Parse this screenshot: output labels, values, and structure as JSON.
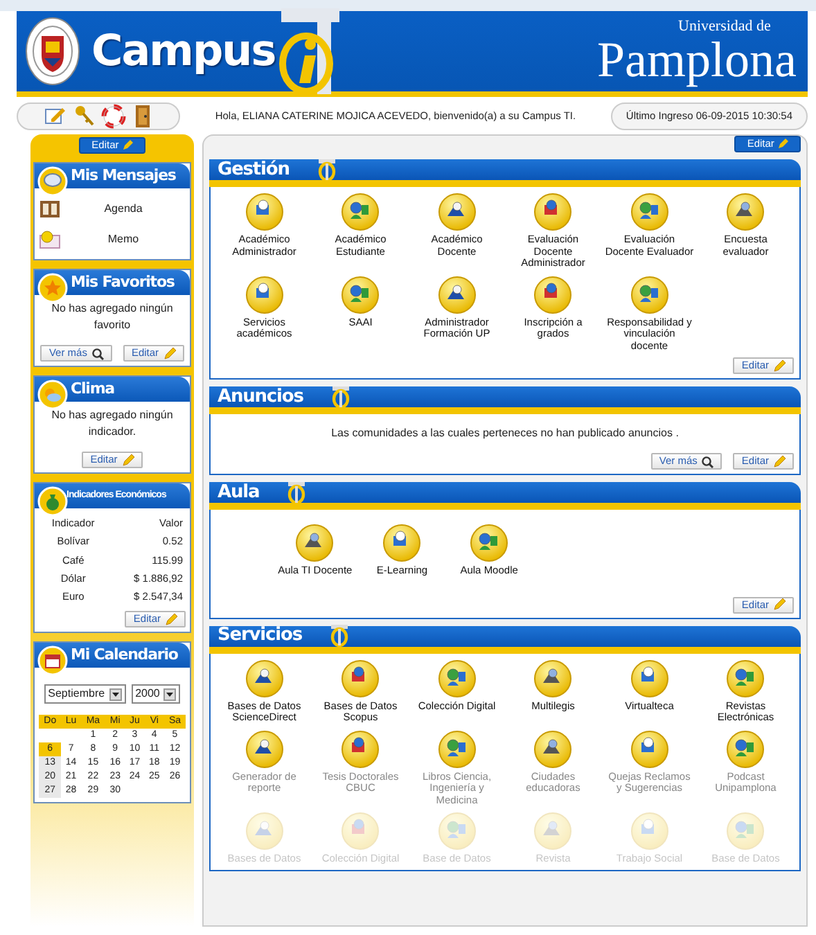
{
  "header": {
    "brand": "Campus",
    "university_small": "Universidad de",
    "university_name": "Pamplona"
  },
  "toolbar": {
    "icons": [
      {
        "kind": "edit"
      },
      {
        "kind": "keys"
      },
      {
        "kind": "lifebuoy"
      },
      {
        "kind": "door"
      }
    ]
  },
  "greeting": "Hola, ELIANA CATERINE MOJICA ACEVEDO, bienvenido(a) a su Campus TI.",
  "last_login": "Último Ingreso 06-09-2015 10:30:54",
  "sidebar": {
    "edit_button": "Editar",
    "widgets": [
      {
        "kind": "messages",
        "title": "Mis Mensajes",
        "items": [
          {
            "label": "Agenda"
          },
          {
            "label": "Memo"
          }
        ]
      },
      {
        "kind": "favorites",
        "title": "Mis Favoritos",
        "text": "No has agregado ningún favorito",
        "buttons": [
          {
            "kind": "search",
            "label": "Ver más"
          },
          {
            "kind": "edit",
            "label": "Editar"
          }
        ]
      },
      {
        "kind": "weather",
        "title": "Clima",
        "text": "No has agregado ningún indicador.",
        "buttons": [
          {
            "kind": "edit",
            "label": "Editar"
          }
        ]
      },
      {
        "kind": "indicators",
        "title": "Indicadores Económicos",
        "columns": [
          "Indicador",
          "Valor"
        ],
        "rows": [
          [
            "Bolívar",
            "0.52"
          ],
          [
            "Café",
            "115.99"
          ],
          [
            "Dólar",
            "$ 1.886,92"
          ],
          [
            "Euro",
            "$ 2.547,34"
          ]
        ],
        "buttons": [
          {
            "kind": "edit",
            "label": "Editar"
          }
        ]
      },
      {
        "kind": "calendar",
        "title": "Mi Calendario",
        "month": "Septiembre",
        "year": "2000",
        "weekdays": [
          "Do",
          "Lu",
          "Ma",
          "Mi",
          "Ju",
          "Vi",
          "Sa"
        ],
        "weeks": [
          [
            {
              "day": "1",
              "selected": false
            },
            {
              "day": "2",
              "selected": false
            },
            {
              "day": "3",
              "selected": false
            },
            {
              "day": "4",
              "selected": false
            },
            {
              "day": "5",
              "selected": false
            }
          ],
          [
            {
              "day": "6",
              "selected": true
            },
            {
              "day": "7",
              "selected": false
            },
            {
              "day": "8",
              "selected": false
            },
            {
              "day": "9",
              "selected": false
            },
            {
              "day": "10",
              "selected": false
            },
            {
              "day": "11",
              "selected": false
            },
            {
              "day": "12",
              "selected": false
            }
          ],
          [
            {
              "day": "13",
              "selected": false
            },
            {
              "day": "14",
              "selected": false
            },
            {
              "day": "15",
              "selected": false
            },
            {
              "day": "16",
              "selected": false
            },
            {
              "day": "17",
              "selected": false
            },
            {
              "day": "18",
              "selected": false
            },
            {
              "day": "19",
              "selected": false
            }
          ],
          [
            {
              "day": "20",
              "selected": false
            },
            {
              "day": "21",
              "selected": false
            },
            {
              "day": "22",
              "selected": false
            },
            {
              "day": "23",
              "selected": false
            },
            {
              "day": "24",
              "selected": false
            },
            {
              "day": "25",
              "selected": false
            },
            {
              "day": "26",
              "selected": false
            }
          ],
          [
            {
              "day": "27",
              "selected": false
            },
            {
              "day": "28",
              "selected": false
            },
            {
              "day": "29",
              "selected": false
            },
            {
              "day": "30",
              "selected": false
            }
          ]
        ]
      }
    ]
  },
  "main": {
    "edit_button": "Editar",
    "sections": [
      {
        "kind": "apps",
        "title": "Gestión",
        "items": [
          {
            "label": "Académico Administrador",
            "kind": "normal"
          },
          {
            "label": "Académico Estudiante",
            "kind": "normal"
          },
          {
            "label": "Académico Docente",
            "kind": "normal"
          },
          {
            "label": "Evaluación Docente Administrador",
            "kind": "normal"
          },
          {
            "label": "Evaluación Docente Evaluador",
            "kind": "normal"
          },
          {
            "label": "Encuesta evaluador",
            "kind": "normal"
          },
          {
            "label": "Servicios académicos",
            "kind": "normal"
          },
          {
            "label": "SAAI",
            "kind": "normal"
          },
          {
            "label": "Administrador Formación UP",
            "kind": "normal"
          },
          {
            "label": "Inscripción a grados",
            "kind": "normal"
          },
          {
            "label": "Responsabilidad y vinculación docente",
            "kind": "normal"
          }
        ],
        "buttons": [
          {
            "kind": "edit",
            "label": "Editar"
          }
        ]
      },
      {
        "kind": "text",
        "title": "Anuncios",
        "text": "Las comunidades a las cuales perteneces no han publicado anuncios .",
        "buttons": [
          {
            "kind": "search",
            "label": "Ver más"
          },
          {
            "kind": "edit",
            "label": "Editar"
          }
        ]
      },
      {
        "kind": "apps",
        "title": "Aula",
        "items": [
          {
            "label": "Aula TI Docente",
            "kind": "normal"
          },
          {
            "label": "E-Learning",
            "kind": "normal"
          },
          {
            "label": "Aula Moodle",
            "kind": "normal"
          }
        ],
        "buttons": [
          {
            "kind": "edit",
            "label": "Editar"
          }
        ]
      },
      {
        "kind": "apps",
        "title": "Servicios",
        "items": [
          {
            "label": "Bases de Datos ScienceDirect",
            "kind": "normal"
          },
          {
            "label": "Bases de Datos Scopus",
            "kind": "normal"
          },
          {
            "label": "Colección Digital",
            "kind": "normal"
          },
          {
            "label": "Multilegis",
            "kind": "normal"
          },
          {
            "label": "Virtualteca",
            "kind": "normal"
          },
          {
            "label": "Revistas Electrónicas",
            "kind": "normal"
          },
          {
            "label": "Generador de reporte",
            "kind": "muted"
          },
          {
            "label": "Tesis Doctorales CBUC",
            "kind": "muted"
          },
          {
            "label": "Libros Ciencia, Ingeniería y Medicina",
            "kind": "muted"
          },
          {
            "label": "Ciudades educadoras",
            "kind": "muted"
          },
          {
            "label": "Quejas Reclamos y Sugerencias",
            "kind": "muted"
          },
          {
            "label": "Podcast Unipamplona",
            "kind": "muted"
          },
          {
            "label": "Bases de Datos",
            "kind": "faded"
          },
          {
            "label": "Colección Digital",
            "kind": "faded"
          },
          {
            "label": "Base de Datos",
            "kind": "faded"
          },
          {
            "label": "Revista",
            "kind": "faded"
          },
          {
            "label": "Trabajo Social",
            "kind": "faded"
          },
          {
            "label": "Base de Datos",
            "kind": "faded"
          }
        ]
      }
    ]
  }
}
